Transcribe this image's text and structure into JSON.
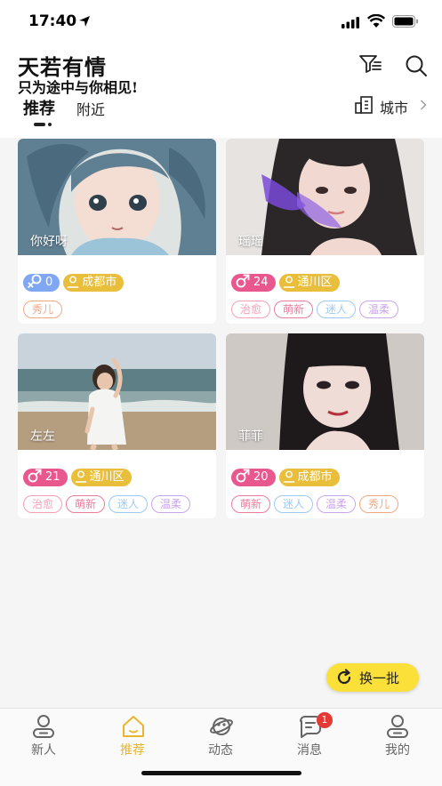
{
  "status_bar": {
    "time": "17:40"
  },
  "header": {
    "title": "天若有情",
    "slogan": "只为途中与你相见!",
    "icons": [
      "filter-icon",
      "search-icon"
    ]
  },
  "tabs": [
    {
      "label": "推荐",
      "active": true
    },
    {
      "label": "附近",
      "active": false
    }
  ],
  "city_filter": {
    "label": "城市"
  },
  "colors": {
    "accent": "#e8b52c",
    "refresh_bg": "#fbe03a",
    "female_badge": "#7fa7f2",
    "male_badge": "#e8588f",
    "city_badge": "#e8be3b",
    "notification_badge": "#e53935"
  },
  "users": [
    {
      "nickname": "你好呀",
      "gender": "female",
      "age": "0",
      "city": "成都市",
      "tags": [
        "秀儿"
      ]
    },
    {
      "nickname": "瑶瑶",
      "gender": "male",
      "age": "24",
      "city": "通川区",
      "tags": [
        "治愈",
        "萌新",
        "迷人",
        "温柔"
      ]
    },
    {
      "nickname": "左左",
      "gender": "male",
      "age": "21",
      "city": "通川区",
      "tags": [
        "治愈",
        "萌新",
        "迷人",
        "温柔"
      ]
    },
    {
      "nickname": "菲菲",
      "gender": "male",
      "age": "20",
      "city": "成都市",
      "tags": [
        "萌新",
        "迷人",
        "温柔",
        "秀儿"
      ]
    }
  ],
  "tag_colors": {
    "秀儿": "#f0a884",
    "治愈": "#f5a0b5",
    "萌新": "#ea7d9c",
    "迷人": "#9ccaf4",
    "温柔": "#c9a6ea"
  },
  "refresh": {
    "label": "换一批"
  },
  "tabbar": [
    {
      "label": "新人",
      "icon": "person-icon"
    },
    {
      "label": "推荐",
      "icon": "home-icon",
      "active": true
    },
    {
      "label": "动态",
      "icon": "planet-icon"
    },
    {
      "label": "消息",
      "icon": "message-icon",
      "badge": "1"
    },
    {
      "label": "我的",
      "icon": "profile-icon"
    }
  ]
}
